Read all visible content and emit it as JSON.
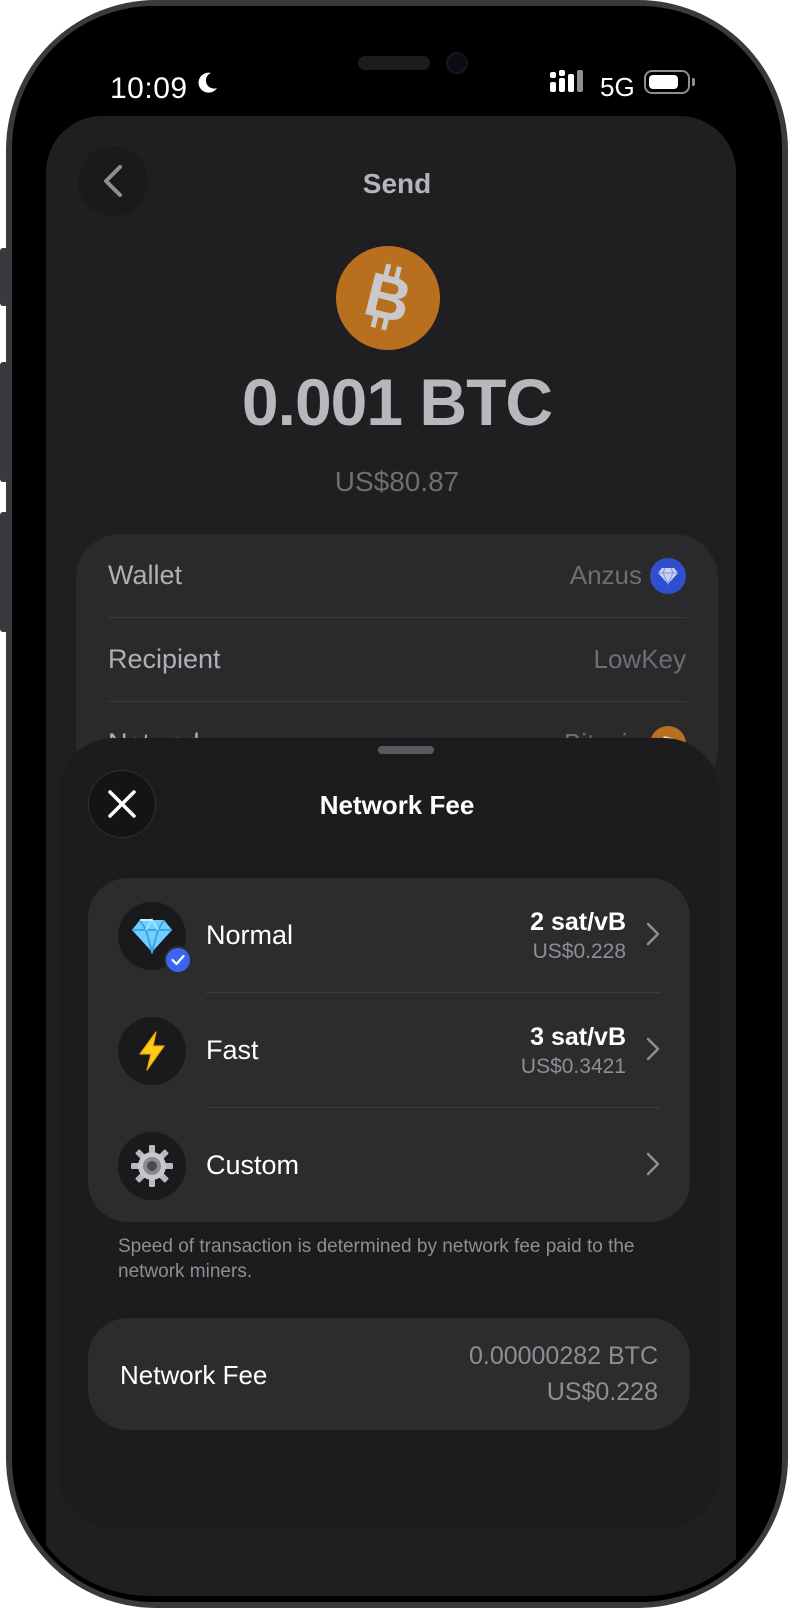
{
  "status_bar": {
    "time": "10:09",
    "network": "5G",
    "battery_level": 0.8,
    "icons": [
      "moon-icon",
      "signal-icon",
      "battery-icon"
    ]
  },
  "send_page": {
    "title": "Send",
    "amount": "0.001 BTC",
    "fiat_amount": "US$80.87",
    "details": [
      {
        "label": "Wallet",
        "value": "Anzus",
        "icon": "diamond-icon"
      },
      {
        "label": "Recipient",
        "value": "LowKey"
      },
      {
        "label": "Network",
        "value": "Bitcoin",
        "icon": "bitcoin-icon"
      }
    ]
  },
  "fee_sheet": {
    "title": "Network Fee",
    "options": [
      {
        "name": "Normal",
        "rate": "2 sat/vB",
        "usd": "US$0.228",
        "icon": "gem-icon",
        "selected": true
      },
      {
        "name": "Fast",
        "rate": "3 sat/vB",
        "usd": "US$0.3421",
        "icon": "lightning-icon",
        "selected": false
      },
      {
        "name": "Custom",
        "rate": "",
        "usd": "",
        "icon": "gear-icon",
        "selected": false
      }
    ],
    "note": "Speed of transaction is determined by network fee paid to the network miners.",
    "summary": {
      "label": "Network Fee",
      "btc": "0.00000282 BTC",
      "usd": "US$0.228"
    }
  },
  "colors": {
    "bitcoin_orange": "#b8701e",
    "accent_blue": "#3c64f0",
    "sheet_background": "#1c1c1e",
    "card_background": "#2c2c2e"
  }
}
